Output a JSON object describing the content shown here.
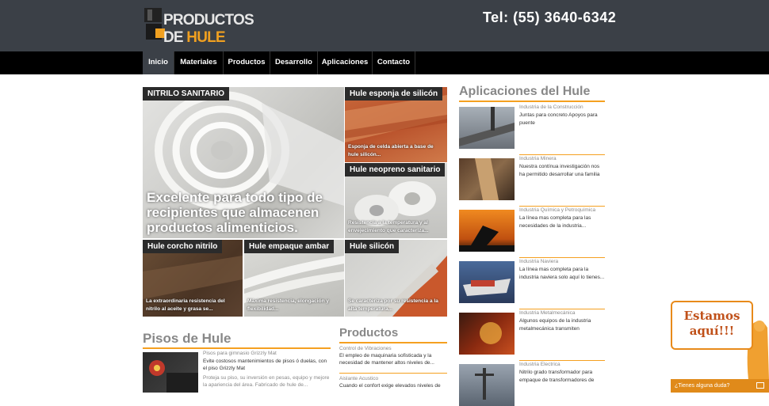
{
  "header": {
    "logo_part1": "PRODUCTOS DE ",
    "logo_part2": "HULE",
    "phone": "Tel: (55) 3640-6342"
  },
  "nav": {
    "items": [
      {
        "label": "Inicio",
        "active": true
      },
      {
        "label": "Materiales"
      },
      {
        "label": "Productos"
      },
      {
        "label": "Desarrollo"
      },
      {
        "label": "Aplicaciones"
      },
      {
        "label": "Contacto"
      }
    ]
  },
  "featured": {
    "big": {
      "label": "NITRILO SANITARIO",
      "caption": "Excelente para todo tipo de recipientes que almacenen productos alimenticios."
    },
    "tiles": [
      {
        "label": "Hule esponja de silicón",
        "caption": "Esponja de celda abierta a base de hule silicón..."
      },
      {
        "label": "Hule neopreno sanitario",
        "caption": "Resistencia a la temperatura y al envejecimiento que caracteriza..."
      },
      {
        "label": "Hule corcho nitrilo",
        "caption": "La extraordinaria resistencia del nitrilo al aceite y grasa se..."
      },
      {
        "label": "Hule empaque ambar",
        "caption": "Máxima resistencia, elongación y flexibilidad..."
      },
      {
        "label": "Hule silicón",
        "caption": "Se caracteriza por su resistencia a la alta temperatura..."
      }
    ]
  },
  "pisos": {
    "heading": "Pisos de Hule",
    "item": {
      "title": "Pisos para gimnasio Grizzly Mat",
      "desc": "Evite costosos mantenimientos de pisos ó duelas, con el piso Grizzly Mat",
      "more": "Proteja su piso, su inversión en pesas, equipo y mejore la apariencia del área. Fabricado de hule de..."
    }
  },
  "productos": {
    "heading": "Productos",
    "items": [
      {
        "title": "Control de Vibraciones",
        "desc": "El empleo de maquinaria sofisticada y la necesidad de mantener altos niveles de..."
      },
      {
        "title": "Aislante Acustico",
        "desc": "Cuando el confort exige elevados niveles de"
      }
    ]
  },
  "aplicaciones": {
    "heading": "Aplicaciones del Hule",
    "items": [
      {
        "title": "Industria de la Construcción",
        "desc": "Juntas para concreto Apoyos para puente"
      },
      {
        "title": "Industria Minera",
        "desc": "Nuestra contínua investigación nos ha permitido desarrollar una familia"
      },
      {
        "title": "Industria Química y Petroquímica",
        "desc": "La línea mas completa para las necesidades de la industria..."
      },
      {
        "title": "Industria Naviera",
        "desc": "La línea mas completa para la industria naviera solo aquí lo tienes..."
      },
      {
        "title": "Industria Metalmecánica",
        "desc": "Algunos equipos de la industria metalmecánica transmiten"
      },
      {
        "title": "Industria Electrica",
        "desc": "Nitrilo grado transformador para empaque de transformadores de"
      }
    ]
  },
  "chat": {
    "bubble_line1": "Estamos",
    "bubble_line2": "aquí!!!",
    "bar": "¿Tienes alguna duda?"
  },
  "colors": {
    "accent": "#f5a020",
    "header_bg": "#3b4047",
    "nav_bg": "#000000"
  }
}
